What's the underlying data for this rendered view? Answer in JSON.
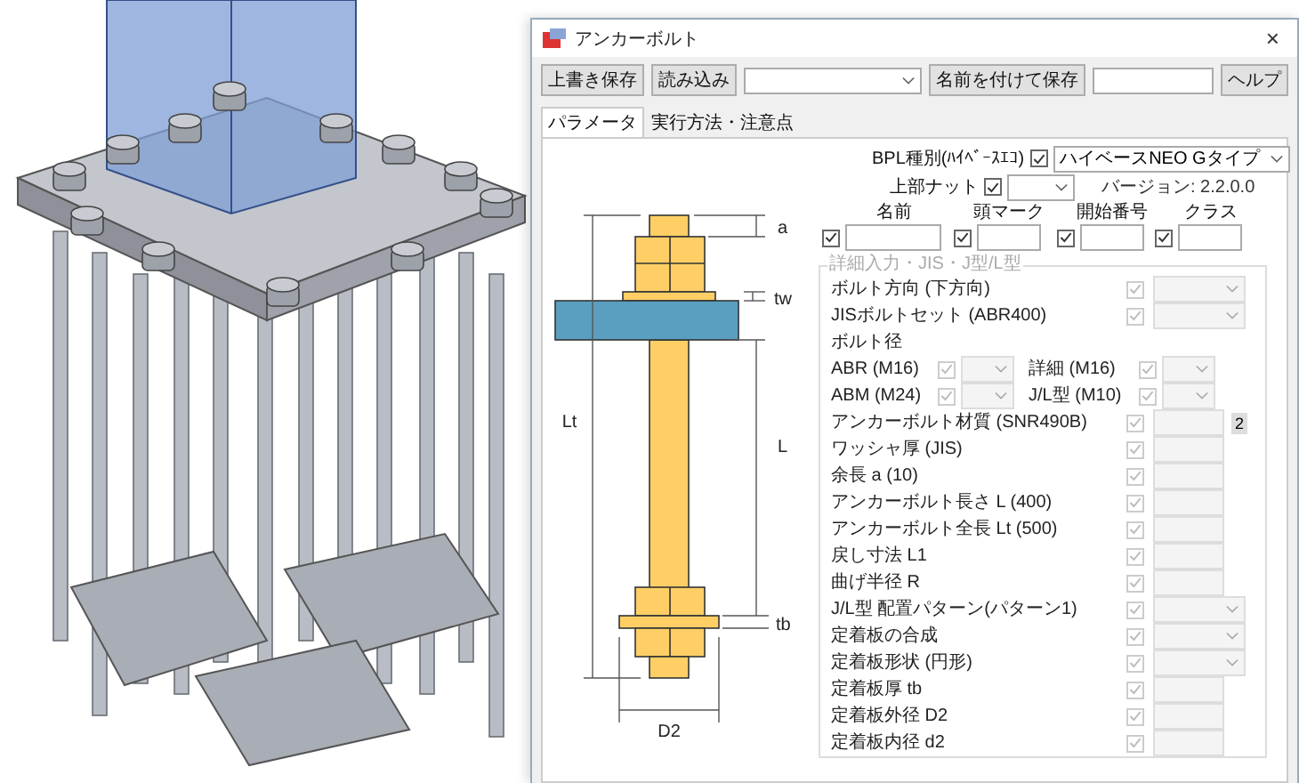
{
  "window": {
    "title": "アンカーボルト",
    "close": "×"
  },
  "toolbar": [
    {
      "kind": "button",
      "label": "上書き保存"
    },
    {
      "kind": "button",
      "label": "読み込み"
    },
    {
      "kind": "combo"
    },
    {
      "kind": "button",
      "label": "名前を付けて保存"
    },
    {
      "kind": "input"
    },
    {
      "kind": "button",
      "label": "ヘルプ"
    }
  ],
  "tabs": [
    {
      "label": "パラメータ",
      "selected": true
    },
    {
      "label": "実行方法・注意点",
      "selected": false
    }
  ],
  "diagram": {
    "labels": [
      {
        "kind": "a",
        "text": "a"
      },
      {
        "kind": "tw",
        "text": "tw"
      },
      {
        "kind": "Lt",
        "text": "Lt"
      },
      {
        "kind": "L",
        "text": "L"
      },
      {
        "kind": "tb",
        "text": "tb"
      },
      {
        "kind": "D2",
        "text": "D2"
      }
    ]
  },
  "bpl": {
    "label": "BPL種別(ﾊｲﾍﾞｰｽｴｺ)",
    "checked": true,
    "value": "ハイベースNEO Gタイプ"
  },
  "top_nut": {
    "label": "上部ナット",
    "checked": true
  },
  "version": "バージョン: 2.2.0.0",
  "marks": [
    {
      "header": "名前",
      "checked": true
    },
    {
      "header": "頭マーク",
      "checked": true
    },
    {
      "header": "開始番号",
      "checked": true
    },
    {
      "header": "クラス",
      "checked": true
    }
  ],
  "detail": {
    "title": "詳細入力・JIS・J型/L型",
    "disabled": true,
    "rows": [
      {
        "kind": "combo",
        "label": "ボルト方向 (下方向)",
        "checked": true
      },
      {
        "kind": "combo",
        "label": "JISボルトセット (ABR400)",
        "checked": true
      },
      {
        "kind": "heading",
        "label": "ボルト径"
      },
      {
        "kind": "pair",
        "items": [
          {
            "label": "ABR (M16)",
            "checked": true
          },
          {
            "label": "詳細 (M16)",
            "checked": true
          }
        ]
      },
      {
        "kind": "pair",
        "items": [
          {
            "label": "ABM (M24)",
            "checked": true
          },
          {
            "label": "J/L型 (M10)",
            "checked": true
          }
        ]
      },
      {
        "kind": "field",
        "label": "アンカーボルト材質 (SNR490B)",
        "checked": true,
        "button": "2"
      },
      {
        "kind": "field",
        "label": "ワッシャ厚 (JIS)",
        "checked": true
      },
      {
        "kind": "field",
        "label": "余長 a (10)",
        "checked": true
      },
      {
        "kind": "field",
        "label": "アンカーボルト長さ L (400)",
        "checked": true
      },
      {
        "kind": "field",
        "label": "アンカーボルト全長 Lt (500)",
        "checked": true
      },
      {
        "kind": "field",
        "label": "戻し寸法 L1",
        "checked": true
      },
      {
        "kind": "field",
        "label": "曲げ半径 R",
        "checked": true
      },
      {
        "kind": "combo",
        "label": "J/L型 配置パターン(パターン1)",
        "checked": true
      },
      {
        "kind": "combo",
        "label": "定着板の合成",
        "checked": true
      },
      {
        "kind": "combo",
        "label": "定着板形状 (円形)",
        "checked": true
      },
      {
        "kind": "field",
        "label": "定着板厚 tb",
        "checked": true
      },
      {
        "kind": "field",
        "label": "定着板外径 D2",
        "checked": true
      },
      {
        "kind": "field",
        "label": "定着板内径 d2",
        "checked": true
      }
    ]
  }
}
